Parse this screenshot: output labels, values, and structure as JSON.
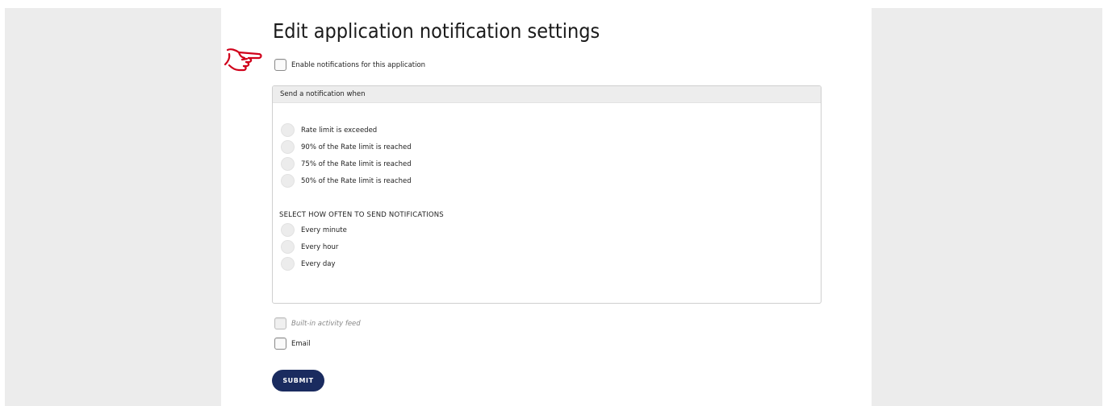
{
  "page": {
    "title": "Edit application notification settings"
  },
  "enable": {
    "label": "Enable notifications for this application",
    "checked": false
  },
  "panel": {
    "header": "Send a notification when",
    "thresholds": [
      {
        "label": "Rate limit is exceeded",
        "selected": false
      },
      {
        "label": "90% of the Rate limit is reached",
        "selected": false
      },
      {
        "label": "75% of the Rate limit is reached",
        "selected": false
      },
      {
        "label": "50% of the Rate limit is reached",
        "selected": false
      }
    ],
    "frequency_heading": "SELECT HOW OFTEN TO SEND NOTIFICATIONS",
    "frequencies": [
      {
        "label": "Every minute",
        "selected": false
      },
      {
        "label": "Every hour",
        "selected": false
      },
      {
        "label": "Every day",
        "selected": false
      }
    ]
  },
  "channels": [
    {
      "label": "Built-in activity feed",
      "checked": false,
      "disabled": true
    },
    {
      "label": "Email",
      "checked": false,
      "disabled": false
    }
  ],
  "submit": {
    "label": "SUBMIT"
  },
  "colors": {
    "submit_bg": "#1a2b5f",
    "pointer_hand": "#d0021b",
    "background": "#ececec"
  },
  "icons": {
    "pointer": "pointing-hand-icon"
  }
}
